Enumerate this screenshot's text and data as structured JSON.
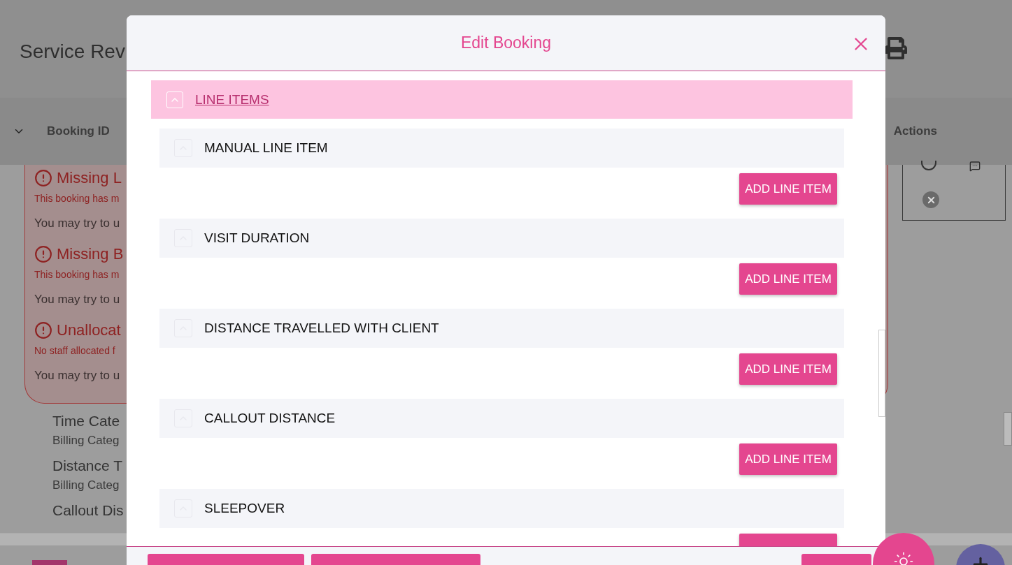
{
  "page": {
    "title": "Service Rev",
    "table_header": {
      "columns": [
        "Booking ID",
        "Actions"
      ]
    },
    "alerts": [
      {
        "title": "Missing L",
        "detail": "This booking has m",
        "hint": "You may try to u"
      },
      {
        "title": "Missing B",
        "detail": "This booking has m",
        "hint": "You may try to u"
      },
      {
        "title": "Unallocat",
        "detail": "No staff allocated f",
        "hint": "You may try to u"
      }
    ],
    "categories": [
      {
        "name": "Time Cate",
        "billing": "Billing Categ"
      },
      {
        "name": "Distance T",
        "billing": "Billing Categ"
      },
      {
        "name": "Callout Dis"
      }
    ]
  },
  "modal": {
    "title": "Edit Booking",
    "section": {
      "title": "LINE ITEMS",
      "expanded": true
    },
    "line_items": [
      {
        "name": "MANUAL LINE ITEM",
        "button": "ADD LINE ITEM"
      },
      {
        "name": "VISIT DURATION",
        "button": "ADD LINE ITEM"
      },
      {
        "name": "DISTANCE TRAVELLED WITH CLIENT",
        "button": "ADD LINE ITEM"
      },
      {
        "name": "CALLOUT DISTANCE",
        "button": "ADD LINE ITEM"
      },
      {
        "name": "SLEEPOVER"
      }
    ]
  }
}
